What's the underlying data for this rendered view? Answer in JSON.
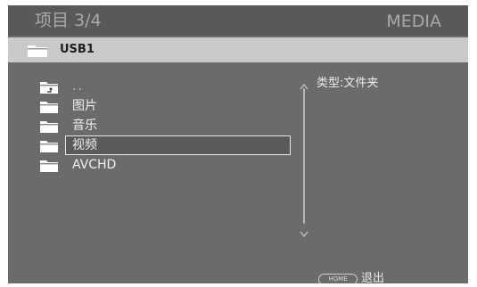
{
  "header": {
    "item_counter": "项目 3/4",
    "mode": "MEDIA"
  },
  "path": {
    "icon": "folder-icon",
    "label": "USB1"
  },
  "files": [
    {
      "label": "..",
      "icon": "parent-folder-icon",
      "selected": false
    },
    {
      "label": "图片",
      "icon": "folder-icon",
      "selected": false
    },
    {
      "label": "音乐",
      "icon": "folder-icon",
      "selected": false
    },
    {
      "label": "视频",
      "icon": "folder-icon",
      "selected": true
    },
    {
      "label": "AVCHD",
      "icon": "folder-icon",
      "selected": false
    }
  ],
  "info": {
    "type_label": "类型:文件夹"
  },
  "footer": {
    "home_key": "HOME",
    "exit_label": "退出"
  },
  "colors": {
    "background": "#6b6b6b",
    "header": "#595959",
    "path_bar": "#c9c9c9",
    "selection_border": "#e6e6e6"
  }
}
